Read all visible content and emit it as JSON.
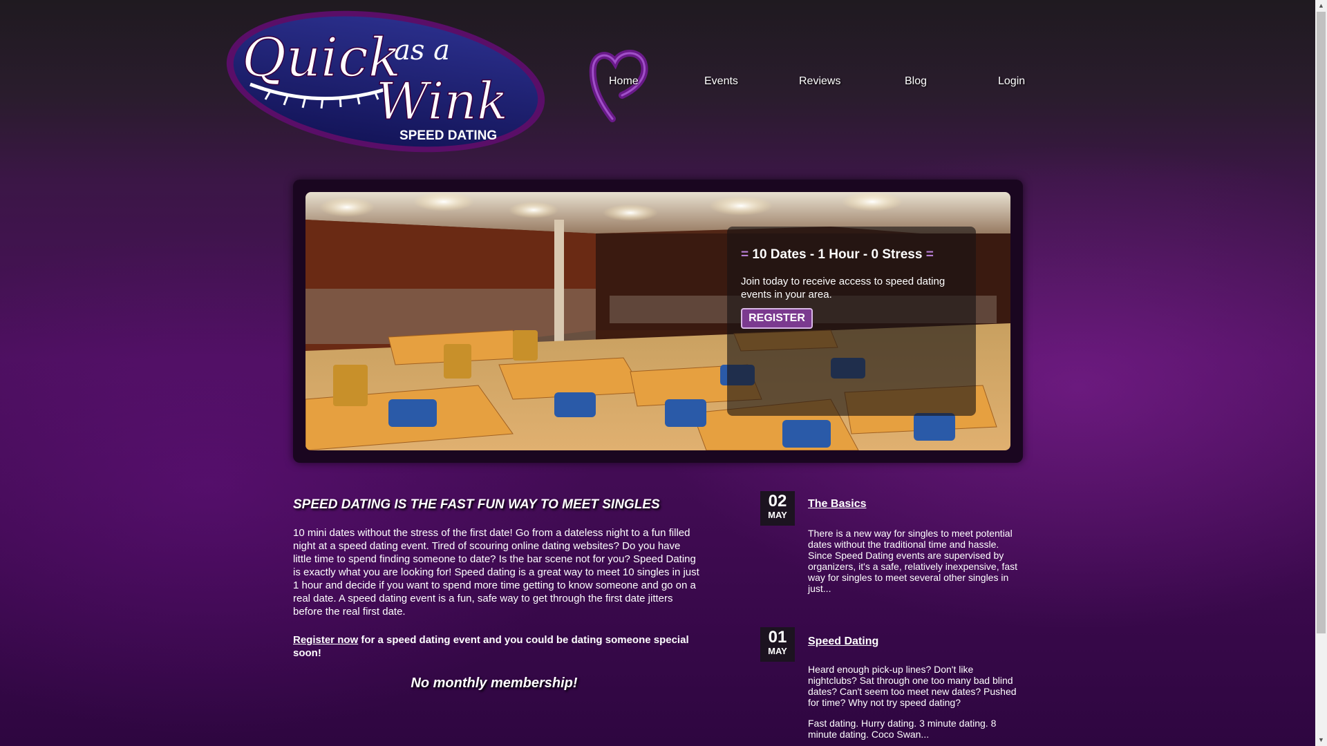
{
  "logo": {
    "line1": "Quick",
    "line2": "as a",
    "line3": "Wink",
    "tagline": "SPEED DATING"
  },
  "nav": {
    "items": [
      {
        "label": "Home"
      },
      {
        "label": "Events"
      },
      {
        "label": "Reviews"
      },
      {
        "label": "Blog"
      },
      {
        "label": "Login"
      }
    ]
  },
  "banner": {
    "title_deco_left": "=",
    "title": "10 Dates - 1 Hour - 0 Stress",
    "title_deco_right": "=",
    "text": "Join today to receive access to speed dating events in your area.",
    "register_label": "REGISTER"
  },
  "main": {
    "headline": "SPEED DATING IS THE FAST FUN WAY TO MEET SINGLES",
    "intro": "10 mini dates without the stress of the first date! Go from a dateless night to a fun filled night at a speed dating event. Tired of scouring online dating websites? Do you have little time to spend finding someone to date? Is the bar scene not for you? Speed Dating is exactly what you are looking for! Speed dating is a great way to meet 10 singles in just 1 hour and decide if you want to spend more time getting to know someone and go on a real date. A speed dating event is a fun, safe way to get through the first date jitters before the real first date.",
    "register_link": "Register now",
    "register_rest": " for a speed dating event and you could be dating someone special soon!",
    "no_membership": "No monthly membership!"
  },
  "posts": [
    {
      "day": "02",
      "month": "MAY",
      "title": "The Basics",
      "body": "There is a new way for singles to meet potential dates without the traditional time and hassle. Since Speed Dating events are supervised by organizers, it's a safe, relatively inexpensive, fast way for singles to meet several other singles in just..."
    },
    {
      "day": "01",
      "month": "MAY",
      "title": "Speed Dating",
      "body": "Heard enough pick-up lines? Don't like nightclubs? Sat through one too many bad blind dates? Can't seem too meet new dates? Pushed for time? Why not try speed dating?",
      "body2": "Fast dating. Hurry dating. 3 minute dating. 8 minute dating. Coco Swan..."
    }
  ],
  "scrollbar": {
    "up_arrow": "▲",
    "down_arrow": "▼"
  }
}
